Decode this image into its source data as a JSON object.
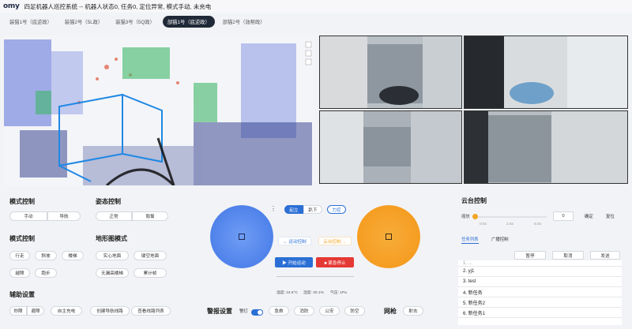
{
  "app": {
    "logo": "omy",
    "title": "四足机器人巡控系统 -- 机器人状态0, 任务0, 定位异常, 模式手动, 未充电"
  },
  "tabs": [
    {
      "label": "装猫1号（底逆政）"
    },
    {
      "label": "装猫2号（5L政）"
    },
    {
      "label": "装猫3号（5Q政）"
    },
    {
      "label": "部猫1号（底逆政）"
    },
    {
      "label": "部猫2号（效帮政）"
    }
  ],
  "mode_control": {
    "title": "模式控制",
    "manual_label": "手动",
    "nav_label": "导航"
  },
  "posture_control": {
    "title": "姿态控制",
    "normal_label": "正常",
    "crawl_label": "匍匐"
  },
  "mode_control2": {
    "title": "模式控制",
    "buttons": [
      "行走",
      "斜坡",
      "楼梯",
      "越障",
      "跑步"
    ]
  },
  "terrain_mode": {
    "title": "地形图模式",
    "buttons": [
      "实心地面",
      "镂空地面",
      "无漏高楼梯",
      "累计帧"
    ]
  },
  "aux": {
    "title": "辅助设置",
    "seg": [
      "你障",
      "避障"
    ],
    "buttons": [
      "自主充电",
      "创建导航线路",
      "查看线路列表"
    ]
  },
  "center": {
    "standup_label": "起立",
    "lie_label": "趴下",
    "force_label": "力控",
    "motion_label": "← 运动控制",
    "gimbal_label": "云台控制 →",
    "start_label": "▶  开始运动",
    "stop_label": "■  紧急停止",
    "temp": "温度: 24.8°C",
    "humidity": "湿度: 30.1%",
    "pressure": "气压: 1Pa"
  },
  "alarm": {
    "title": "警报设置",
    "alert_label": "警灯",
    "alert_on": true,
    "buttons": [
      "急救",
      "消防",
      "公安",
      "防空"
    ]
  },
  "net_gun": {
    "title": "网枪",
    "fire_label": "射击"
  },
  "gimbal": {
    "title": "云台控制",
    "zoom_label": "缩放",
    "zoom_scale": [
      "0.5x",
      "2.5x",
      "5.0x"
    ],
    "zoom_level": 0.03,
    "angle_value": "0",
    "confirm_label": "确定",
    "reset_label": "复位",
    "tabs": [
      "任务列表",
      "广播控制"
    ],
    "actions": [
      "暂停",
      "取消",
      "发送"
    ]
  },
  "tasks": [
    "1. ...",
    "2. yj1",
    "3. test",
    "4. 新任务",
    "5. 新任务2",
    "6. 新任务1"
  ],
  "colors": {
    "blue_joystick": "#5b8def",
    "orange_joystick": "#f5a623",
    "accent": "#2b6fd6",
    "danger": "#e53935"
  }
}
